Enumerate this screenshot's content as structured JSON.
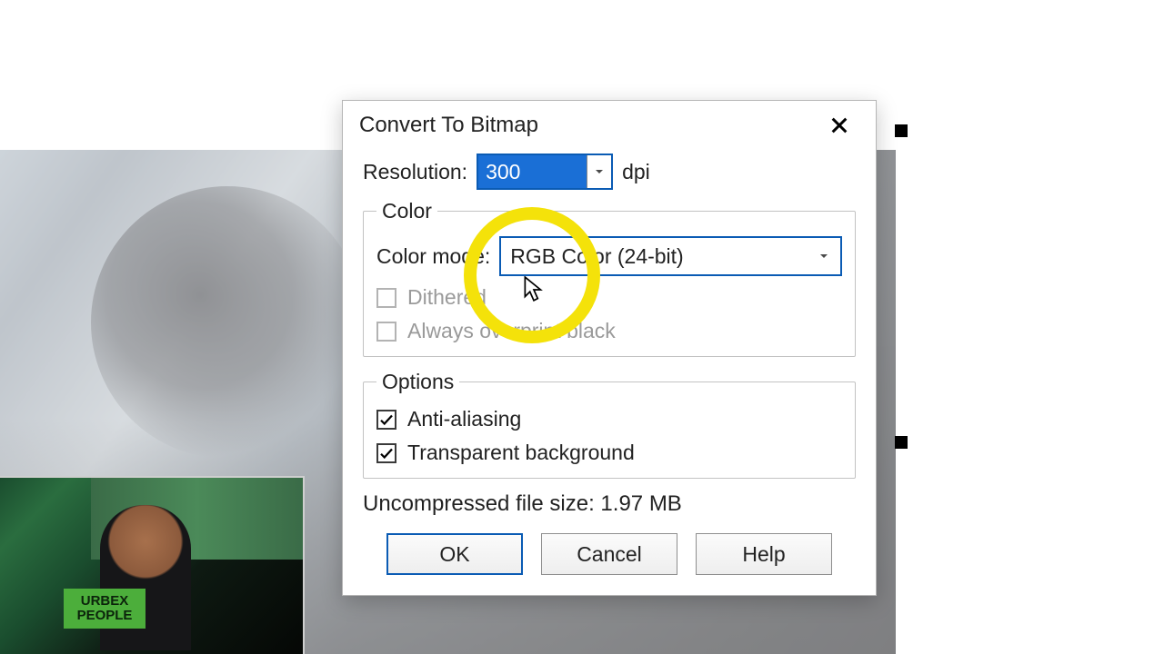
{
  "dialog": {
    "title": "Convert To Bitmap",
    "resolution": {
      "label": "Resolution:",
      "value": "300",
      "unit": "dpi"
    },
    "color_group": {
      "legend": "Color",
      "mode_label": "Color mode:",
      "mode_value": "RGB Color (24-bit)",
      "dithered_label": "Dithered",
      "dithered_checked": false,
      "dithered_disabled": true,
      "overprint_label": "Always overprint black",
      "overprint_checked": false,
      "overprint_disabled": true
    },
    "options_group": {
      "legend": "Options",
      "antialias_label": "Anti-aliasing",
      "antialias_checked": true,
      "transparent_label": "Transparent background",
      "transparent_checked": true
    },
    "filesize_text": "Uncompressed file size: 1.97 MB",
    "buttons": {
      "ok": "OK",
      "cancel": "Cancel",
      "help": "Help"
    }
  },
  "pip": {
    "sticker_text": "URBEX\nPEOPLE"
  }
}
